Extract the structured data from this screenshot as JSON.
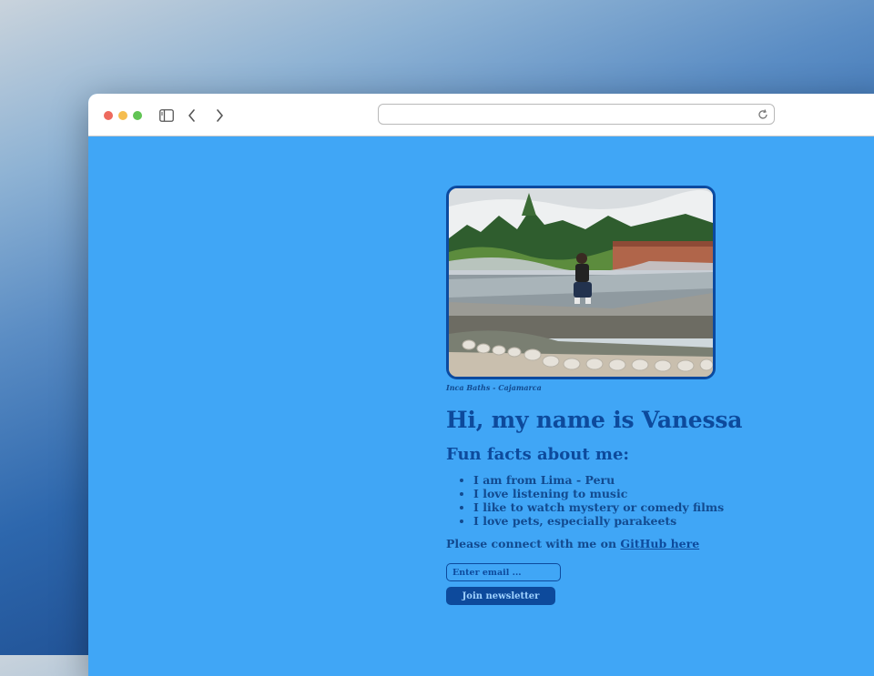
{
  "browser": {
    "url": ""
  },
  "page": {
    "photo_caption": "Inca Baths - Cajamarca",
    "heading": "Hi, my name is Vanessa",
    "subheading": "Fun facts about me:",
    "facts": [
      "I am from Lima - Peru",
      "I love listening to music",
      "I like to watch mystery or comedy films",
      "I love pets, especially parakeets"
    ],
    "connect_prefix": "Please connect with me on ",
    "github_link": "GitHub here",
    "email_placeholder": "Enter email ...",
    "newsletter_button": "Join newsletter"
  },
  "colors": {
    "page_background": "#40a6f6",
    "text_primary": "#0d4a9c",
    "button_background": "#0d4a9c"
  },
  "icons": [
    "sidebar-icon",
    "chevron-left-icon",
    "chevron-right-icon",
    "reload-icon"
  ]
}
